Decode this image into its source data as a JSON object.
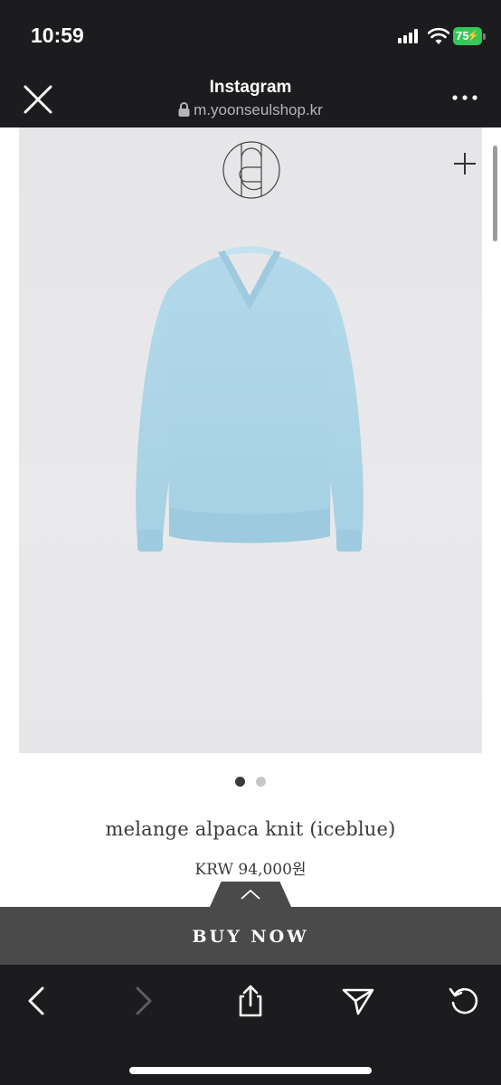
{
  "status_bar": {
    "time": "10:59",
    "battery": "75"
  },
  "browser_header": {
    "title": "Instagram",
    "url": "m.yoonseulshop.kr"
  },
  "product": {
    "name": "melange alpaca knit (iceblue)",
    "price": "KRW 94,000원",
    "image_count": 2,
    "active_image": 1,
    "sweater_color": "#a9d3e6"
  },
  "buy_bar": {
    "label": "BUY NOW"
  },
  "toolbar": {
    "items": [
      "back-icon",
      "forward-icon",
      "share-icon",
      "send-icon",
      "reload-icon"
    ]
  },
  "colors": {
    "chrome_bg": "#1c1c1e",
    "battery": "#35c759",
    "buy_bar": "#4a4a4a",
    "image_bg": "#e8e8ea"
  }
}
